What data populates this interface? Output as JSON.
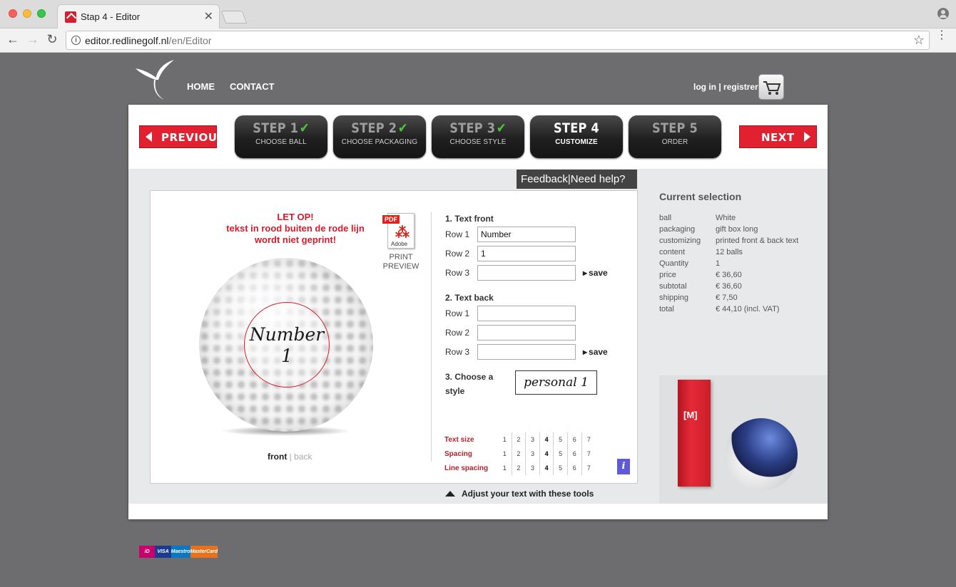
{
  "browser": {
    "tab_title": "Stap 4 - Editor",
    "tab_close": "✕",
    "url_host": "editor.redlinegolf.nl",
    "url_path": "/en/Editor",
    "back": "←",
    "forward": "→",
    "reload": "↻",
    "star": "☆",
    "menu": "⋮"
  },
  "header": {
    "nav": [
      {
        "label": "HOME"
      },
      {
        "label": "CONTACT"
      }
    ],
    "login": "log in | registrer"
  },
  "wizard": {
    "previous": "PREVIOUS",
    "next": "NEXT",
    "check": "✔",
    "steps": [
      {
        "num": "STEP 1",
        "sub": "CHOOSE BALL",
        "done": true
      },
      {
        "num": "STEP 2",
        "sub": "CHOOSE PACKAGING",
        "done": true
      },
      {
        "num": "STEP 3",
        "sub": "CHOOSE STYLE",
        "done": true
      },
      {
        "num": "STEP 4",
        "sub": "CUSTOMIZE",
        "current": true
      },
      {
        "num": "STEP 5",
        "sub": "ORDER"
      }
    ]
  },
  "help": {
    "feedback": "Feedback",
    "separator": "|",
    "need_help": "Need help?"
  },
  "editor": {
    "warning": [
      "LET OP!",
      "tekst in rood buiten de rode lijn",
      "wordt niet geprint!"
    ],
    "pdf": {
      "tag": "PDF",
      "glyph": "⁂",
      "brand": "Adobe",
      "line1": "PRINT",
      "line2": "PREVIEW"
    },
    "ball_text": [
      "Number",
      "1"
    ],
    "view": {
      "front": "front",
      "sep": " | ",
      "back": "back"
    },
    "text_front": {
      "title": "1. Text front",
      "rows": [
        {
          "label": "Row 1",
          "value": "Number"
        },
        {
          "label": "Row 2",
          "value": "1"
        },
        {
          "label": "Row 3",
          "value": ""
        }
      ]
    },
    "text_back": {
      "title": "2. Text back",
      "rows": [
        {
          "label": "Row 1",
          "value": ""
        },
        {
          "label": "Row 2",
          "value": ""
        },
        {
          "label": "Row 3",
          "value": ""
        }
      ]
    },
    "save": "save",
    "style_label": "3. Choose a style",
    "style_value": "personal 1",
    "tools": [
      {
        "label": "Text size",
        "values": [
          "1",
          "2",
          "3",
          "4",
          "5",
          "6",
          "7"
        ],
        "selected": 4
      },
      {
        "label": "Spacing",
        "values": [
          "1",
          "2",
          "3",
          "4",
          "5",
          "6",
          "7"
        ],
        "selected": 4
      },
      {
        "label": "Line spacing",
        "values": [
          "1",
          "2",
          "3",
          "4",
          "5",
          "6",
          "7"
        ],
        "selected": 4
      }
    ],
    "info": "i",
    "adjust_hint": "Adjust your text with these tools"
  },
  "selection": {
    "title": "Current selection",
    "rows": [
      {
        "k": "ball",
        "v": "White"
      },
      {
        "k": "packaging",
        "v": "gift box long"
      },
      {
        "k": "customizing",
        "v": "printed front & back text"
      },
      {
        "k": "content",
        "v": "12 balls"
      },
      {
        "k": "Quantity",
        "v": "1"
      },
      {
        "k": "price",
        "v": "€ 36,60"
      },
      {
        "k": "subtotal",
        "v": "€ 36,60"
      },
      {
        "k": "shipping",
        "v": "€ 7,50"
      },
      {
        "k": "total",
        "v": "€ 44,10 (incl. VAT)"
      }
    ],
    "package_label": "[M]"
  },
  "payments": [
    {
      "label": "iD",
      "color": "#c8006e"
    },
    {
      "label": "VISA",
      "color": "#1a3b8f"
    },
    {
      "label": "Maestro",
      "color": "#0a78c2"
    },
    {
      "label": "MasterCard",
      "color": "#e8721c"
    }
  ]
}
